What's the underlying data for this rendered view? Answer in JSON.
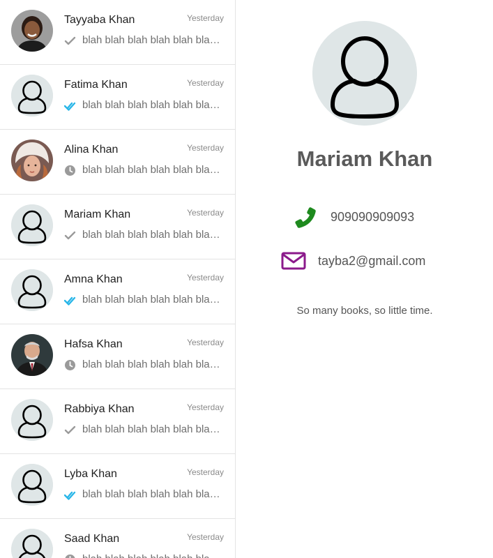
{
  "chat_list": [
    {
      "name": "Tayyaba Khan",
      "time": "Yesterday",
      "preview": "blah blah blah blah blah blah blah",
      "status": "sent",
      "avatar": "photo-woman-smiling"
    },
    {
      "name": "Fatima Khan",
      "time": "Yesterday",
      "preview": "blah blah blah blah blah blah blah",
      "status": "read",
      "avatar": "default-user"
    },
    {
      "name": "Alina Khan",
      "time": "Yesterday",
      "preview": "blah blah blah blah blah blah blah",
      "status": "pending",
      "avatar": "photo-girl-winter-hat"
    },
    {
      "name": "Mariam Khan",
      "time": "Yesterday",
      "preview": "blah blah blah blah blah blah blah",
      "status": "sent",
      "avatar": "default-user"
    },
    {
      "name": "Amna Khan",
      "time": "Yesterday",
      "preview": "blah blah blah blah blah blah blah",
      "status": "read",
      "avatar": "default-user"
    },
    {
      "name": "Hafsa Khan",
      "time": "Yesterday",
      "preview": "blah blah blah blah blah blah blah",
      "status": "pending",
      "avatar": "photo-man-suit"
    },
    {
      "name": "Rabbiya Khan",
      "time": "Yesterday",
      "preview": "blah blah blah blah blah blah blah",
      "status": "sent",
      "avatar": "default-user"
    },
    {
      "name": "Lyba Khan",
      "time": "Yesterday",
      "preview": "blah blah blah blah blah blah blah",
      "status": "read",
      "avatar": "default-user"
    },
    {
      "name": "Saad Khan",
      "time": "Yesterday",
      "preview": "blah blah blah blah blah blah blah",
      "status": "pending",
      "avatar": "default-user"
    }
  ],
  "contact": {
    "name": "Mariam Khan",
    "phone": "909090909093",
    "email": "tayba2@gmail.com",
    "status": "So many books, so little time.",
    "avatar": "default-user"
  },
  "colors": {
    "phone_icon": "#1e8a1e",
    "mail_icon": "#8b1a8b",
    "read_tick": "#29b6e8",
    "sent_tick": "#9a9a9a",
    "avatar_bg": "#dfe6e7"
  }
}
